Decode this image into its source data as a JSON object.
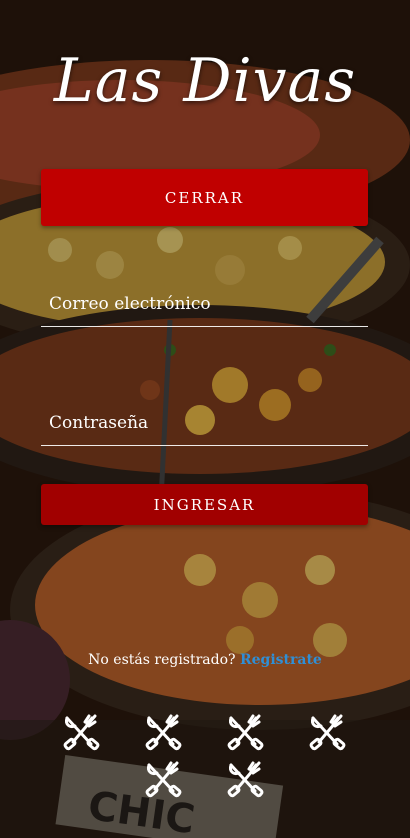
{
  "brand": {
    "name": "Las Divas"
  },
  "buttons": {
    "close_label": "CERRAR",
    "login_label": "INGRESAR"
  },
  "form": {
    "email_placeholder": "Correo electrónico",
    "password_placeholder": "Contraseña"
  },
  "register": {
    "prompt": "No estás registrado?",
    "link_label": "Registrate"
  },
  "colors": {
    "close_button": "#c00000",
    "login_button": "#a10000",
    "link": "#2f8fd6"
  },
  "icons": [
    "cutlery-icon",
    "cutlery-icon",
    "cutlery-icon",
    "cutlery-icon",
    "cutlery-icon",
    "cutlery-icon"
  ]
}
